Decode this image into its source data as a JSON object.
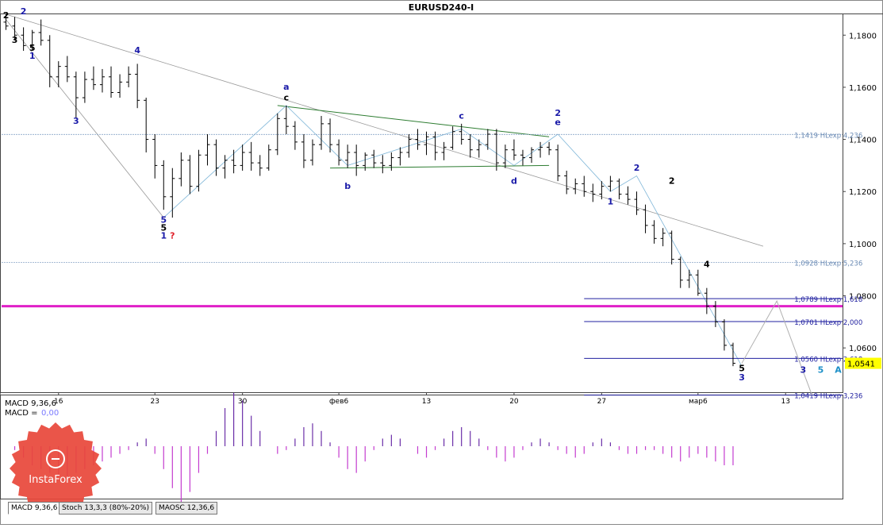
{
  "title": "EURUSD240-I",
  "brand": {
    "text": "InstaForex",
    "color": "#e8473a"
  },
  "current_price": {
    "label": "1,0541",
    "value": 1.0541,
    "color": "#ffff00"
  },
  "chart_data": {
    "type": "candlestick",
    "title": "EURUSD240-I",
    "ylim": [
      1.043,
      1.188
    ],
    "y_ticks": [
      {
        "value": 1.18,
        "label": "1,1800"
      },
      {
        "value": 1.16,
        "label": "1,1600"
      },
      {
        "value": 1.14,
        "label": "1,1400"
      },
      {
        "value": 1.12,
        "label": "1,1200"
      },
      {
        "value": 1.1,
        "label": "1,1000"
      },
      {
        "value": 1.08,
        "label": "1,0800"
      },
      {
        "value": 1.06,
        "label": "1,0600"
      }
    ],
    "x_ticks": [
      {
        "index": 6,
        "label": "16"
      },
      {
        "index": 17,
        "label": "23"
      },
      {
        "index": 27,
        "label": "30"
      },
      {
        "index": 38,
        "label": "фев6"
      },
      {
        "index": 48,
        "label": "13"
      },
      {
        "index": 58,
        "label": "20"
      },
      {
        "index": 68,
        "label": "27"
      },
      {
        "index": 79,
        "label": "мар6"
      },
      {
        "index": 89,
        "label": "13"
      }
    ],
    "candles": [
      [
        1.185,
        1.188,
        1.182,
        1.1835
      ],
      [
        1.1835,
        1.187,
        1.178,
        1.18
      ],
      [
        1.18,
        1.183,
        1.174,
        1.176
      ],
      [
        1.176,
        1.182,
        1.174,
        1.181
      ],
      [
        1.181,
        1.186,
        1.176,
        1.178
      ],
      [
        1.178,
        1.18,
        1.16,
        1.164
      ],
      [
        1.164,
        1.17,
        1.16,
        1.168
      ],
      [
        1.168,
        1.172,
        1.162,
        1.164
      ],
      [
        1.164,
        1.166,
        1.148,
        1.156
      ],
      [
        1.156,
        1.166,
        1.154,
        1.163
      ],
      [
        1.163,
        1.168,
        1.159,
        1.161
      ],
      [
        1.161,
        1.167,
        1.158,
        1.164
      ],
      [
        1.164,
        1.168,
        1.156,
        1.158
      ],
      [
        1.158,
        1.165,
        1.156,
        1.162
      ],
      [
        1.162,
        1.168,
        1.16,
        1.165
      ],
      [
        1.165,
        1.169,
        1.152,
        1.155
      ],
      [
        1.155,
        1.156,
        1.135,
        1.14
      ],
      [
        1.14,
        1.142,
        1.125,
        1.13
      ],
      [
        1.13,
        1.132,
        1.113,
        1.118
      ],
      [
        1.118,
        1.129,
        1.11,
        1.125
      ],
      [
        1.125,
        1.135,
        1.122,
        1.132
      ],
      [
        1.132,
        1.134,
        1.119,
        1.122
      ],
      [
        1.122,
        1.136,
        1.12,
        1.134
      ],
      [
        1.134,
        1.142,
        1.13,
        1.138
      ],
      [
        1.138,
        1.14,
        1.126,
        1.129
      ],
      [
        1.129,
        1.134,
        1.125,
        1.132
      ],
      [
        1.132,
        1.136,
        1.127,
        1.13
      ],
      [
        1.13,
        1.138,
        1.128,
        1.135
      ],
      [
        1.135,
        1.139,
        1.128,
        1.131
      ],
      [
        1.131,
        1.134,
        1.126,
        1.129
      ],
      [
        1.129,
        1.138,
        1.128,
        1.136
      ],
      [
        1.136,
        1.15,
        1.134,
        1.148
      ],
      [
        1.148,
        1.153,
        1.142,
        1.145
      ],
      [
        1.145,
        1.147,
        1.136,
        1.139
      ],
      [
        1.139,
        1.142,
        1.129,
        1.132
      ],
      [
        1.132,
        1.14,
        1.13,
        1.138
      ],
      [
        1.138,
        1.149,
        1.136,
        1.146
      ],
      [
        1.146,
        1.148,
        1.135,
        1.138
      ],
      [
        1.138,
        1.14,
        1.13,
        1.132
      ],
      [
        1.132,
        1.138,
        1.129,
        1.135
      ],
      [
        1.135,
        1.138,
        1.126,
        1.13
      ],
      [
        1.13,
        1.135,
        1.128,
        1.134
      ],
      [
        1.134,
        1.136,
        1.129,
        1.131
      ],
      [
        1.131,
        1.134,
        1.127,
        1.13
      ],
      [
        1.13,
        1.135,
        1.128,
        1.133
      ],
      [
        1.133,
        1.137,
        1.13,
        1.135
      ],
      [
        1.135,
        1.142,
        1.133,
        1.14
      ],
      [
        1.14,
        1.144,
        1.136,
        1.138
      ],
      [
        1.138,
        1.143,
        1.134,
        1.141
      ],
      [
        1.141,
        1.143,
        1.132,
        1.135
      ],
      [
        1.135,
        1.139,
        1.132,
        1.137
      ],
      [
        1.137,
        1.145,
        1.136,
        1.143
      ],
      [
        1.143,
        1.146,
        1.138,
        1.14
      ],
      [
        1.14,
        1.142,
        1.133,
        1.136
      ],
      [
        1.136,
        1.14,
        1.133,
        1.138
      ],
      [
        1.138,
        1.144,
        1.136,
        1.142
      ],
      [
        1.142,
        1.144,
        1.128,
        1.131
      ],
      [
        1.131,
        1.138,
        1.129,
        1.136
      ],
      [
        1.136,
        1.14,
        1.132,
        1.134
      ],
      [
        1.134,
        1.136,
        1.13,
        1.133
      ],
      [
        1.133,
        1.137,
        1.131,
        1.136
      ],
      [
        1.136,
        1.139,
        1.133,
        1.137
      ],
      [
        1.137,
        1.139,
        1.134,
        1.136
      ],
      [
        1.136,
        1.138,
        1.124,
        1.126
      ],
      [
        1.126,
        1.128,
        1.119,
        1.121
      ],
      [
        1.121,
        1.125,
        1.119,
        1.123
      ],
      [
        1.123,
        1.126,
        1.118,
        1.12
      ],
      [
        1.12,
        1.123,
        1.116,
        1.119
      ],
      [
        1.119,
        1.124,
        1.117,
        1.122
      ],
      [
        1.122,
        1.126,
        1.12,
        1.124
      ],
      [
        1.124,
        1.125,
        1.117,
        1.119
      ],
      [
        1.119,
        1.122,
        1.115,
        1.117
      ],
      [
        1.117,
        1.12,
        1.111,
        1.113
      ],
      [
        1.113,
        1.115,
        1.104,
        1.107
      ],
      [
        1.107,
        1.109,
        1.1,
        1.102
      ],
      [
        1.102,
        1.106,
        1.099,
        1.104
      ],
      [
        1.104,
        1.105,
        1.092,
        1.094
      ],
      [
        1.094,
        1.095,
        1.083,
        1.086
      ],
      [
        1.086,
        1.09,
        1.083,
        1.088
      ],
      [
        1.088,
        1.09,
        1.08,
        1.081
      ],
      [
        1.081,
        1.083,
        1.073,
        1.076
      ],
      [
        1.076,
        1.078,
        1.068,
        1.07
      ],
      [
        1.07,
        1.071,
        1.059,
        1.061
      ],
      [
        1.061,
        1.062,
        1.053,
        1.0541
      ]
    ],
    "levels": [
      {
        "value": 1.1419,
        "label": "1,1419 HLexp 4,236",
        "style": "light"
      },
      {
        "value": 1.0928,
        "label": "1,0928 HLexp 5,236",
        "style": "light"
      },
      {
        "value": 1.0789,
        "label": "1,0789 HLexp 1,618",
        "style": "dark"
      },
      {
        "value": 1.0701,
        "label": "1,0701 HLexp 2,000",
        "style": "dark"
      },
      {
        "value": 1.056,
        "label": "1,0560 HLexp 2,618",
        "style": "dark"
      },
      {
        "value": 1.0419,
        "label": "1,0419 HLexp 3,236",
        "style": "dark"
      }
    ],
    "support_level": 1.076,
    "wave_labels": [
      {
        "index": 0,
        "value": 1.1865,
        "text": "2",
        "color": "#000000"
      },
      {
        "index": 2,
        "value": 1.188,
        "text": "2",
        "color": "#1a1aa8"
      },
      {
        "index": 1,
        "value": 1.177,
        "text": "3",
        "color": "#000000"
      },
      {
        "index": 3,
        "value": 1.174,
        "text": "5",
        "color": "#000000"
      },
      {
        "index": 3,
        "value": 1.171,
        "text": "1",
        "color": "#1a1aa8"
      },
      {
        "index": 8,
        "value": 1.146,
        "text": "3",
        "color": "#1a1aa8"
      },
      {
        "index": 15,
        "value": 1.173,
        "text": "4",
        "color": "#1a1aa8"
      },
      {
        "index": 18,
        "value": 1.108,
        "text": "5",
        "color": "#1a1aa8"
      },
      {
        "index": 18,
        "value": 1.105,
        "text": "5",
        "color": "#000000"
      },
      {
        "index": 18,
        "value": 1.102,
        "text": "1",
        "color": "#1a1aa8"
      },
      {
        "index": 19,
        "value": 1.102,
        "text": "?",
        "color": "#e0202a"
      },
      {
        "index": 32,
        "value": 1.159,
        "text": "a",
        "color": "#1a1aa8"
      },
      {
        "index": 32,
        "value": 1.155,
        "text": "c",
        "color": "#000000"
      },
      {
        "index": 39,
        "value": 1.121,
        "text": "b",
        "color": "#1a1aa8"
      },
      {
        "index": 52,
        "value": 1.148,
        "text": "c",
        "color": "#1a1aa8"
      },
      {
        "index": 58,
        "value": 1.123,
        "text": "d",
        "color": "#1a1aa8"
      },
      {
        "index": 63,
        "value": 1.149,
        "text": "2",
        "color": "#1a1aa8"
      },
      {
        "index": 63,
        "value": 1.1455,
        "text": "e",
        "color": "#1a1aa8"
      },
      {
        "index": 69,
        "value": 1.115,
        "text": "1",
        "color": "#1a1aa8"
      },
      {
        "index": 72,
        "value": 1.128,
        "text": "2",
        "color": "#1a1aa8"
      },
      {
        "index": 76,
        "value": 1.123,
        "text": "2",
        "color": "#000000"
      },
      {
        "index": 80,
        "value": 1.091,
        "text": "4",
        "color": "#000000"
      },
      {
        "index": 84,
        "value": 1.051,
        "text": "5",
        "color": "#000000"
      },
      {
        "index": 84,
        "value": 1.0475,
        "text": "3",
        "color": "#1a1aa8"
      },
      {
        "index": 91,
        "value": 1.0505,
        "text": "3",
        "color": "#1a1aa8"
      },
      {
        "index": 93,
        "value": 1.0505,
        "text": "5",
        "color": "#1e90c8"
      },
      {
        "index": 95,
        "value": 1.0505,
        "text": "A",
        "color": "#1e90c8"
      }
    ],
    "projection": [
      {
        "index": 84,
        "value": 1.0541
      },
      {
        "index": 88,
        "value": 1.078
      },
      {
        "index": 92,
        "value": 1.042
      }
    ]
  },
  "indicator": {
    "label_line1": "MACD 9,36,6",
    "label_prefix": "MACD =",
    "label_value": "0,00",
    "histogram": [
      0,
      -1,
      -3,
      -5,
      -6,
      -7,
      -8,
      -8,
      -7,
      -6,
      -5,
      -4,
      -3,
      -2,
      -1,
      1,
      2,
      -2,
      -6,
      -11,
      -15,
      -12,
      -7,
      -2,
      4,
      10,
      14,
      12,
      8,
      4,
      0,
      -2,
      -1,
      2,
      5,
      6,
      4,
      1,
      -3,
      -6,
      -7,
      -4,
      -1,
      2,
      3,
      2,
      0,
      -2,
      -3,
      -1,
      2,
      4,
      5,
      4,
      2,
      -1,
      -3,
      -4,
      -3,
      -1,
      1,
      2,
      1,
      -1,
      -2,
      -3,
      -2,
      1,
      2,
      1,
      -1,
      -2,
      -2,
      -1,
      -1,
      -2,
      -3,
      -4,
      -3,
      -2,
      -3,
      -4,
      -5,
      -5
    ],
    "tabs": [
      "MACD 9,36,6",
      "Stoch 13,3,3 (80%-20%)",
      "MAOSC 12,36,6"
    ]
  }
}
